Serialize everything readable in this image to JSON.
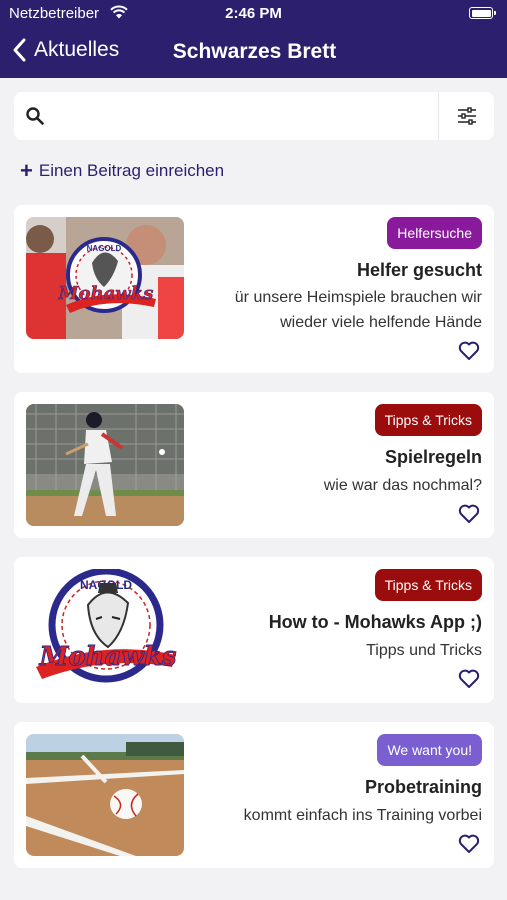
{
  "status_bar": {
    "carrier": "Netzbetreiber",
    "time": "2:46 PM"
  },
  "nav": {
    "back_label": "Aktuelles",
    "title": "Schwarzes Brett"
  },
  "search": {
    "value": "",
    "placeholder": ""
  },
  "submit": {
    "label": "Einen Beitrag einreichen"
  },
  "colors": {
    "header_bg": "#2b1f6e",
    "badge_helfersuche": "#8a1a9c",
    "badge_tipps": "#9b0c0c",
    "badge_wewant": "#7b5fd0"
  },
  "cards": [
    {
      "badge": "Helfersuche",
      "title": "Helfer gesucht",
      "description": "ür unsere Heimspiele brauchen wir wieder viele helfende Hände",
      "image": "team-logo-photo",
      "logo_top": "NAGOLD",
      "logo_script": "Mohawks",
      "favorite_icon": "heart-outline-icon"
    },
    {
      "badge": "Tipps & Tricks",
      "title": "Spielregeln",
      "description": "wie war das nochmal?",
      "image": "batter-photo",
      "favorite_icon": "heart-outline-icon"
    },
    {
      "badge": "Tipps & Tricks",
      "title": "How to - Mohawks App ;)",
      "description": "Tipps und Tricks",
      "image": "mohawks-logo",
      "logo_top": "NAGOLD",
      "logo_script": "Mohawks",
      "favorite_icon": "heart-outline-icon"
    },
    {
      "badge": "We want you!",
      "title": "Probetraining",
      "description": "kommt einfach ins Training vorbei",
      "image": "baseball-field-photo",
      "favorite_icon": "heart-outline-icon"
    }
  ]
}
